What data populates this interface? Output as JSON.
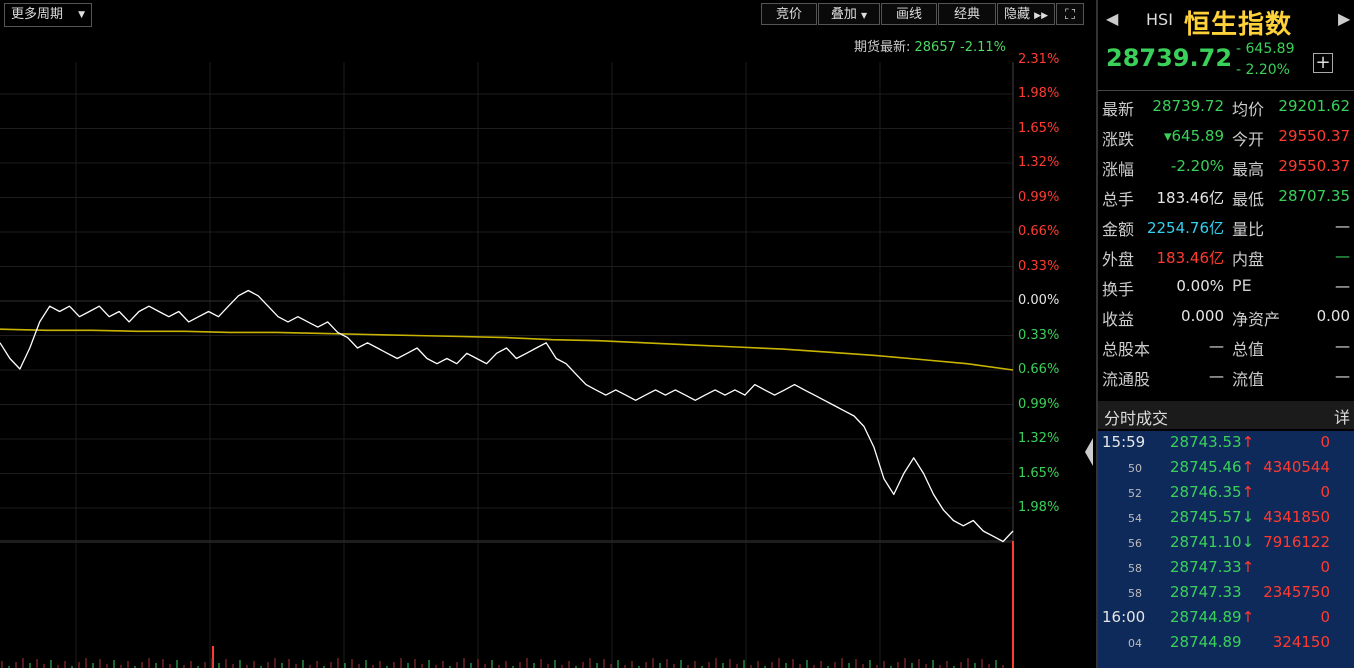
{
  "toolbar": {
    "period": "更多周期",
    "buttons": [
      "竞价",
      "叠加",
      "画线",
      "经典",
      "隐藏"
    ]
  },
  "futures": {
    "label": "期货最新:",
    "price": "28657",
    "change": "-2.11%"
  },
  "axis": {
    "upper": [
      "2.31%",
      "1.98%",
      "1.65%",
      "1.32%",
      "0.99%",
      "0.66%",
      "0.33%"
    ],
    "zero": "0.00%",
    "lower": [
      "0.33%",
      "0.66%",
      "0.99%",
      "1.32%",
      "1.65%",
      "1.98%"
    ]
  },
  "chart_data": {
    "type": "line",
    "range_pct": [
      -2.31,
      2.31
    ],
    "colors": {
      "price": "#ffffff",
      "average": "#c8b400",
      "up_axis": "#ff3b30",
      "down_axis": "#3ad15a"
    },
    "series": [
      {
        "values": [
          -0.4,
          -0.55,
          -0.65,
          -0.45,
          -0.2,
          -0.05,
          -0.1,
          -0.05,
          -0.15,
          -0.1,
          -0.05,
          -0.15,
          -0.1,
          -0.2,
          -0.1,
          -0.05,
          -0.1,
          -0.15,
          -0.1,
          -0.2,
          -0.15,
          -0.1,
          -0.15,
          -0.05,
          0.05,
          0.1,
          0.05,
          -0.05,
          -0.15,
          -0.2,
          -0.15,
          -0.2,
          -0.25,
          -0.2,
          -0.3,
          -0.35,
          -0.45,
          -0.4,
          -0.45,
          -0.5,
          -0.55,
          -0.5,
          -0.45,
          -0.55,
          -0.6,
          -0.55,
          -0.6,
          -0.5,
          -0.55,
          -0.6,
          -0.5,
          -0.45,
          -0.55,
          -0.5,
          -0.45,
          -0.4,
          -0.55,
          -0.6,
          -0.7,
          -0.8,
          -0.85,
          -0.9,
          -0.85,
          -0.9,
          -0.95,
          -0.9,
          -0.85,
          -0.9,
          -0.85,
          -0.9,
          -0.95,
          -0.9,
          -0.85,
          -0.9,
          -0.85,
          -0.9,
          -0.8,
          -0.85,
          -0.9,
          -0.85,
          -0.8,
          -0.85,
          -0.9,
          -0.95,
          -1.0,
          -1.05,
          -1.1,
          -1.2,
          -1.4,
          -1.7,
          -1.85,
          -1.65,
          -1.5,
          -1.65,
          -1.85,
          -2.0,
          -2.1,
          -2.15,
          -2.1,
          -2.2,
          -2.25,
          -2.3,
          -2.2
        ]
      },
      {
        "values": [
          -0.27,
          -0.28,
          -0.28,
          -0.29,
          -0.29,
          -0.3,
          -0.3,
          -0.31,
          -0.32,
          -0.33,
          -0.34,
          -0.35,
          -0.37,
          -0.38,
          -0.4,
          -0.42,
          -0.44,
          -0.46,
          -0.49,
          -0.52,
          -0.56,
          -0.6,
          -0.66
        ]
      }
    ]
  },
  "quote": {
    "code": "HSI",
    "name": "恒生指数",
    "price": "28739.72",
    "change": "- 645.89",
    "change_pct": "- 2.20%",
    "rows": [
      {
        "l1": "最新",
        "v1": "28739.72",
        "c1": "green",
        "l2": "均价",
        "v2": "29201.62",
        "c2": "green"
      },
      {
        "l1": "涨跌",
        "v1": "▾645.89",
        "c1": "green",
        "l2": "今开",
        "v2": "29550.37",
        "c2": "red"
      },
      {
        "l1": "涨幅",
        "v1": "-2.20%",
        "c1": "green",
        "l2": "最高",
        "v2": "29550.37",
        "c2": "red"
      },
      {
        "l1": "总手",
        "v1": "183.46亿",
        "c1": "white",
        "l2": "最低",
        "v2": "28707.35",
        "c2": "green"
      },
      {
        "l1": "金额",
        "v1": "2254.76亿",
        "c1": "cyan",
        "l2": "量比",
        "v2": "—",
        "c2": "white"
      },
      {
        "l1": "外盘",
        "v1": "183.46亿",
        "c1": "red",
        "l2": "内盘",
        "v2": "—",
        "c2": "green"
      },
      {
        "l1": "换手",
        "v1": "0.00%",
        "c1": "white",
        "l2": "PE",
        "v2": "—",
        "c2": "white"
      },
      {
        "l1": "收益",
        "v1": "0.000",
        "c1": "white",
        "l2": "净资产",
        "v2": "0.00",
        "c2": "white"
      },
      {
        "l1": "总股本",
        "v1": "—",
        "c1": "white",
        "l2": "总值",
        "v2": "—",
        "c2": "white"
      },
      {
        "l1": "流通股",
        "v1": "—",
        "c1": "white",
        "l2": "流值",
        "v2": "—",
        "c2": "white"
      }
    ]
  },
  "trades": {
    "title": "分时成交",
    "detail": "详",
    "rows": [
      {
        "time": "15:59",
        "price": "28743.53",
        "dir": "↑",
        "vol": "0"
      },
      {
        "time": "50",
        "price": "28745.46",
        "dir": "↑",
        "vol": "4340544"
      },
      {
        "time": "52",
        "price": "28746.35",
        "dir": "↑",
        "vol": "0"
      },
      {
        "time": "54",
        "price": "28745.57",
        "dir": "↓",
        "vol": "4341850"
      },
      {
        "time": "56",
        "price": "28741.10",
        "dir": "↓",
        "vol": "7916122"
      },
      {
        "time": "58",
        "price": "28747.33",
        "dir": "↑",
        "vol": "0"
      },
      {
        "time": "58",
        "price": "28747.33",
        "dir": "",
        "vol": "2345750"
      },
      {
        "time": "16:00",
        "price": "28744.89",
        "dir": "↑",
        "vol": "0"
      },
      {
        "time": "04",
        "price": "28744.89",
        "dir": "",
        "vol": "324150"
      }
    ]
  }
}
